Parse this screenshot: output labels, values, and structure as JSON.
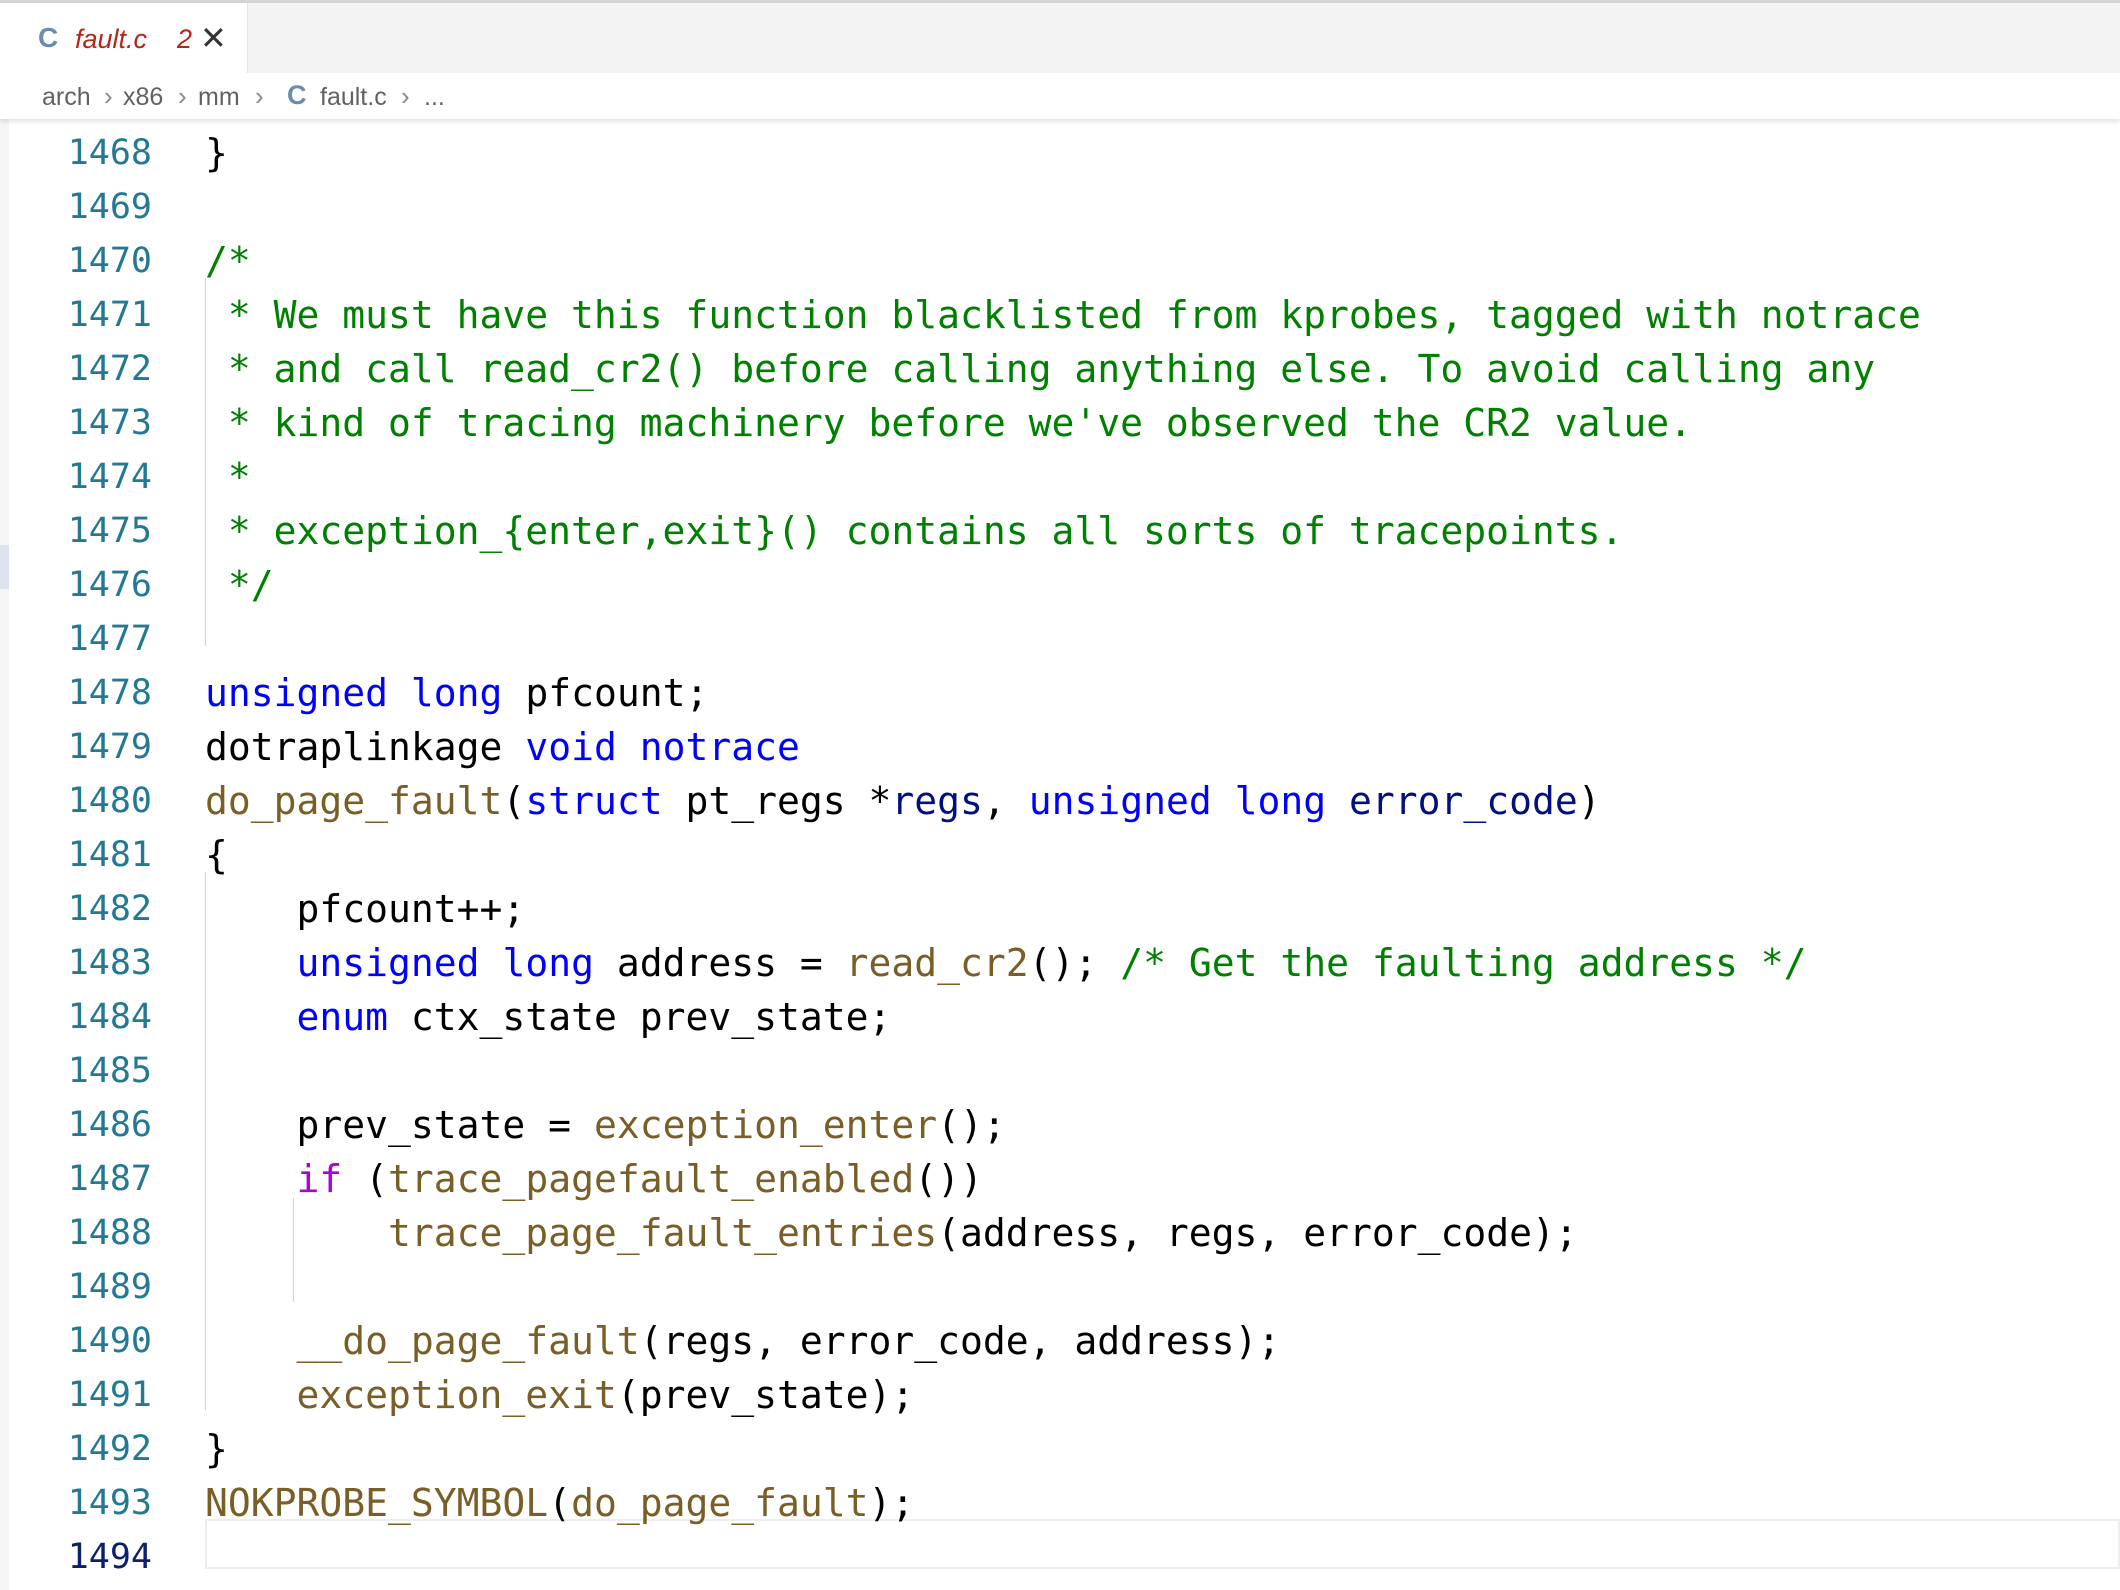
{
  "tab": {
    "lang_icon": "C",
    "filename": "fault.c",
    "problems_count": "2",
    "close_glyph": "✕"
  },
  "breadcrumb": {
    "items": [
      "arch",
      "x86",
      "mm",
      "fault.c",
      "..."
    ],
    "file_icon": "C",
    "separator": "›"
  },
  "editor": {
    "active_line": "1494",
    "lines": [
      {
        "n": "1468",
        "code": "}"
      },
      {
        "n": "1469",
        "code": ""
      },
      {
        "n": "1470",
        "code": "/*"
      },
      {
        "n": "1471",
        "code": " * We must have this function blacklisted from kprobes, tagged with notrace"
      },
      {
        "n": "1472",
        "code": " * and call read_cr2() before calling anything else. To avoid calling any"
      },
      {
        "n": "1473",
        "code": " * kind of tracing machinery before we've observed the CR2 value."
      },
      {
        "n": "1474",
        "code": " *"
      },
      {
        "n": "1475",
        "code": " * exception_{enter,exit}() contains all sorts of tracepoints."
      },
      {
        "n": "1476",
        "code": " */"
      },
      {
        "n": "1477",
        "code": ""
      },
      {
        "n": "1478",
        "code": "unsigned long pfcount;"
      },
      {
        "n": "1479",
        "code": "dotraplinkage void notrace"
      },
      {
        "n": "1480",
        "code": "do_page_fault(struct pt_regs *regs, unsigned long error_code)"
      },
      {
        "n": "1481",
        "code": "{"
      },
      {
        "n": "1482",
        "code": "    pfcount++;"
      },
      {
        "n": "1483",
        "code": "    unsigned long address = read_cr2(); /* Get the faulting address */"
      },
      {
        "n": "1484",
        "code": "    enum ctx_state prev_state;"
      },
      {
        "n": "1485",
        "code": ""
      },
      {
        "n": "1486",
        "code": "    prev_state = exception_enter();"
      },
      {
        "n": "1487",
        "code": "    if (trace_pagefault_enabled())"
      },
      {
        "n": "1488",
        "code": "        trace_page_fault_entries(address, regs, error_code);"
      },
      {
        "n": "1489",
        "code": ""
      },
      {
        "n": "1490",
        "code": "    __do_page_fault(regs, error_code, address);"
      },
      {
        "n": "1491",
        "code": "    exception_exit(prev_state);"
      },
      {
        "n": "1492",
        "code": "}"
      },
      {
        "n": "1493",
        "code": "NOKPROBE_SYMBOL(do_page_fault);"
      },
      {
        "n": "1494",
        "code": ""
      }
    ]
  },
  "colors": {
    "keyword": "#0000ff",
    "type": "#0000ff",
    "control": "#af00db",
    "function": "#795e26",
    "comment": "#008000",
    "parameter": "#001080",
    "text": "#000000",
    "line_number": "#237893",
    "active_line_number": "#0b216f"
  }
}
